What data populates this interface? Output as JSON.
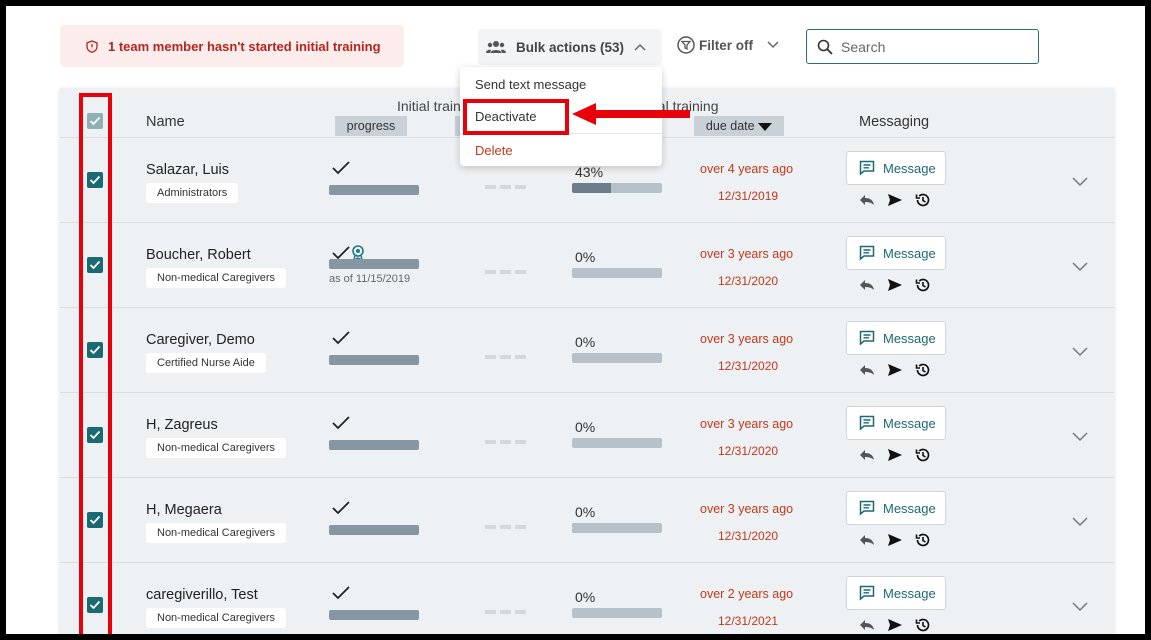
{
  "alert": {
    "text": "1 team member hasn't started initial training"
  },
  "toolbar": {
    "bulk_label": "Bulk actions (53)",
    "filter_label": "Filter off",
    "search_placeholder": "Search"
  },
  "menu": {
    "send_text": "Send text message",
    "deactivate": "Deactivate",
    "delete": "Delete"
  },
  "table": {
    "name_header": "Name",
    "initial_header": "Initial traini",
    "annual_header": "ual training",
    "progress_sub": "progress",
    "due_sub": "due date",
    "messaging_header": "Messaging",
    "rows": [
      {
        "name": "Salazar, Luis",
        "role": "Administrators",
        "pct": "43%",
        "fill": 0.43,
        "ago": "over 4 years ago",
        "due": "12/31/2019",
        "award": false,
        "asof": ""
      },
      {
        "name": "Boucher, Robert",
        "role": "Non-medical Caregivers",
        "pct": "0%",
        "fill": 0,
        "ago": "over 3 years ago",
        "due": "12/31/2020",
        "award": true,
        "asof": "as of 11/15/2019"
      },
      {
        "name": "Caregiver, Demo",
        "role": "Certified Nurse Aide",
        "pct": "0%",
        "fill": 0,
        "ago": "over 3 years ago",
        "due": "12/31/2020",
        "award": false,
        "asof": ""
      },
      {
        "name": "H, Zagreus",
        "role": "Non-medical Caregivers",
        "pct": "0%",
        "fill": 0,
        "ago": "over 3 years ago",
        "due": "12/31/2020",
        "award": false,
        "asof": ""
      },
      {
        "name": "H, Megaera",
        "role": "Non-medical Caregivers",
        "pct": "0%",
        "fill": 0,
        "ago": "over 3 years ago",
        "due": "12/31/2020",
        "award": false,
        "asof": ""
      },
      {
        "name": "caregiverillo, Test",
        "role": "Non-medical Caregivers",
        "pct": "0%",
        "fill": 0,
        "ago": "over 2 years ago",
        "due": "12/31/2021",
        "award": false,
        "asof": ""
      }
    ],
    "message_label": "Message"
  }
}
